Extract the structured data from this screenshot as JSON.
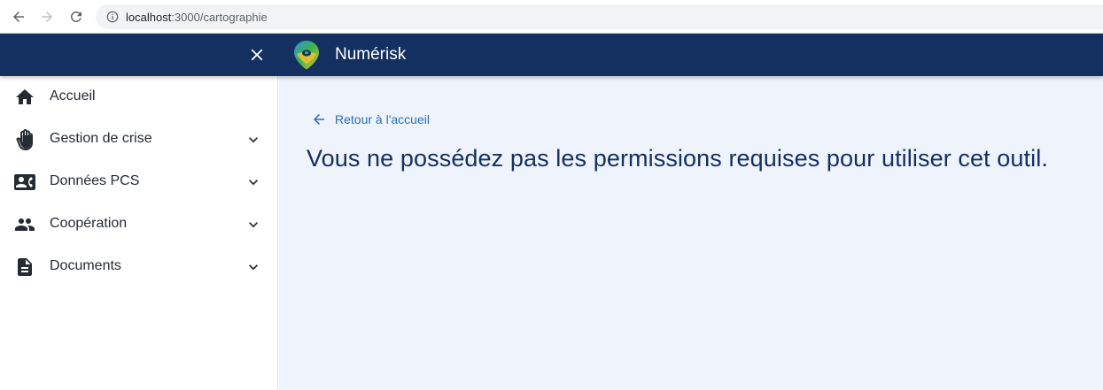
{
  "browser": {
    "url_host": "localhost",
    "url_path": ":3000/cartographie",
    "icons": [
      "back-arrow-icon",
      "forward-arrow-icon",
      "reload-icon",
      "info-icon"
    ]
  },
  "appbar": {
    "title": "Numérisk",
    "close_icon": "close-icon",
    "background": "#133061"
  },
  "sidebar": {
    "items": [
      {
        "label": "Accueil",
        "icon": "home-icon",
        "expandable": false
      },
      {
        "label": "Gestion de crise",
        "icon": "hand-icon",
        "expandable": true
      },
      {
        "label": "Données PCS",
        "icon": "contact-card-icon",
        "expandable": true
      },
      {
        "label": "Coopération",
        "icon": "people-icon",
        "expandable": true
      },
      {
        "label": "Documents",
        "icon": "document-icon",
        "expandable": true
      }
    ]
  },
  "main": {
    "back_label": "Retour à l'accueil",
    "heading": "Vous ne possédez pas les permissions requises pour utiliser cet outil.",
    "background": "#eef3fc",
    "link_color": "#2a6fb8"
  }
}
